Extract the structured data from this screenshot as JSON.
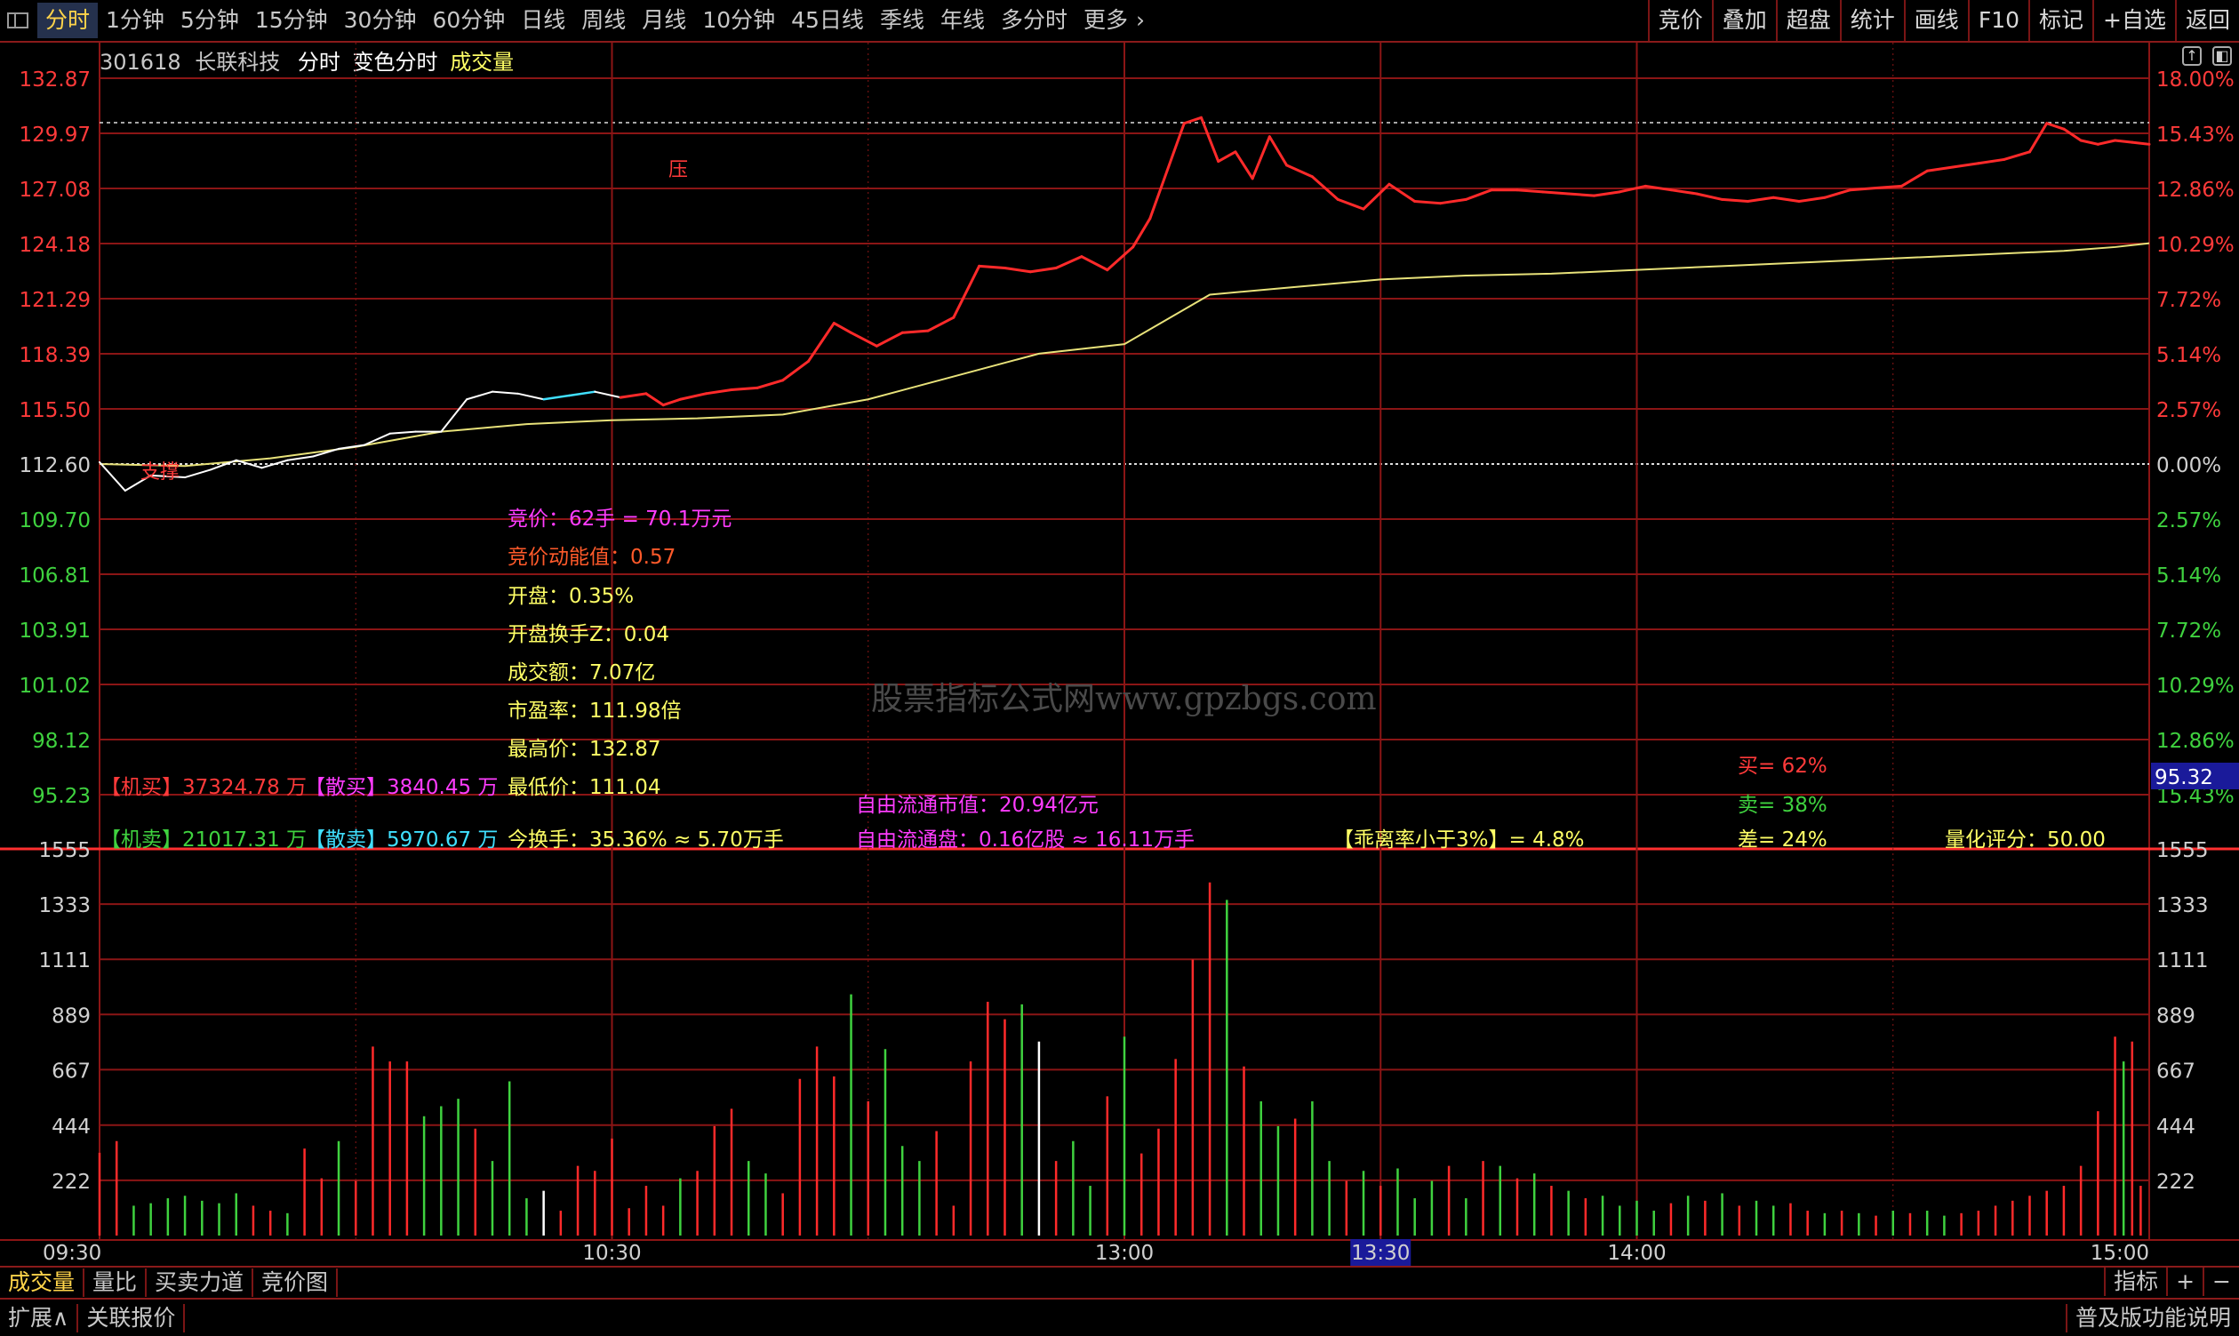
{
  "colors": {
    "up": "#ff2a2a",
    "down": "#3fd23f",
    "price_line": "#ffffff",
    "avg_line": "#e8e27a",
    "grid": "#8b1515",
    "label_yellow": "#ffff66",
    "label_magenta": "#ff3cff"
  },
  "toolbar": {
    "periods": [
      "分时",
      "1分钟",
      "5分钟",
      "15分钟",
      "30分钟",
      "60分钟",
      "日线",
      "周线",
      "月线",
      "10分钟",
      "45日线",
      "季线",
      "年线",
      "多分时",
      "更多"
    ],
    "active_period": "分时",
    "right_tools": [
      "竞价",
      "叠加",
      "超盘",
      "统计",
      "画线",
      "F10",
      "标记",
      "+自选",
      "返回"
    ]
  },
  "header": {
    "code": "301618",
    "name": "长联科技",
    "mode": "分时",
    "color_mode": "变色分时",
    "indicator": "成交量"
  },
  "price_axis": {
    "left": [
      "132.87",
      "129.97",
      "127.08",
      "124.18",
      "121.29",
      "118.39",
      "115.50",
      "112.60",
      "109.70",
      "106.81",
      "103.91",
      "101.02",
      "98.12",
      "95.23"
    ],
    "right": [
      "18.00%",
      "15.43%",
      "12.86%",
      "10.29%",
      "7.72%",
      "5.14%",
      "2.57%",
      "0.00%",
      "2.57%",
      "5.14%",
      "7.72%",
      "10.29%",
      "12.86%",
      "15.43%"
    ],
    "cursor_price": "95.32"
  },
  "volume_axis": {
    "labels": [
      "1555",
      "1333",
      "1111",
      "889",
      "667",
      "444",
      "222"
    ]
  },
  "time_axis": {
    "labels": [
      "09:30",
      "10:30",
      "13:00",
      "13:30",
      "14:00",
      "15:00"
    ],
    "highlight": "13:30"
  },
  "chart_labels": {
    "pressure": "压",
    "support": "支撑"
  },
  "info": {
    "auction": "竞价：62手 = 70.1万元",
    "auction_momentum": "竞价动能值：0.57",
    "open": "开盘：0.35%",
    "open_turnover": "开盘换手Z：0.04",
    "amount": "成交额：7.07亿",
    "pe": "市盈率：111.98倍",
    "high": "最高价：132.87",
    "low": "最低价：111.04",
    "turnover": "今换手：35.36% ≈ 5.70万手",
    "inst_buy": "【机买】37324.78 万",
    "retail_buy": "【散买】3840.45 万",
    "inst_sell": "【机卖】21017.31 万",
    "retail_sell": "【散卖】5970.67 万",
    "float_value": "自由流通市值：20.94亿元",
    "float_shares": "自由流通盘：0.16亿股 ≈ 16.11万手",
    "deviation": "【乖离率小于3%】= 4.8%",
    "buy_pct": "买= 62%",
    "sell_pct": "卖= 38%",
    "diff_pct": "差= 24%",
    "quant_score": "量化评分：50.00"
  },
  "watermark": "股票指标公式网www.gpzbgs.com",
  "bottom_tabs": [
    "成交量",
    "量比",
    "买卖力道",
    "竞价图"
  ],
  "bottom_right": [
    "指标",
    "+",
    "−"
  ],
  "status_bar": {
    "left": [
      "扩展∧",
      "关联报价"
    ],
    "right": "普及版功能说明"
  },
  "chart_data": {
    "type": "line",
    "prev_close": 112.6,
    "ylim": [
      95.23,
      132.87
    ],
    "x_range_minutes": 240,
    "price": [
      [
        0,
        112.7
      ],
      [
        3,
        111.2
      ],
      [
        6,
        112.0
      ],
      [
        10,
        111.9
      ],
      [
        13,
        112.3
      ],
      [
        16,
        112.8
      ],
      [
        19,
        112.4
      ],
      [
        22,
        112.8
      ],
      [
        25,
        113.0
      ],
      [
        28,
        113.4
      ],
      [
        31,
        113.6
      ],
      [
        34,
        114.2
      ],
      [
        37,
        114.3
      ],
      [
        40,
        114.3
      ],
      [
        43,
        116.0
      ],
      [
        46,
        116.4
      ],
      [
        49,
        116.3
      ],
      [
        52,
        116.0
      ],
      [
        55,
        116.2
      ],
      [
        58,
        116.4
      ],
      [
        61,
        116.1
      ],
      [
        64,
        116.3
      ],
      [
        66,
        115.7
      ],
      [
        68,
        116.0
      ],
      [
        71,
        116.3
      ],
      [
        74,
        116.5
      ],
      [
        77,
        116.6
      ],
      [
        80,
        117.0
      ],
      [
        83,
        118.0
      ],
      [
        86,
        120.0
      ],
      [
        88,
        119.5
      ],
      [
        91,
        118.8
      ],
      [
        94,
        119.5
      ],
      [
        97,
        119.6
      ],
      [
        100,
        120.3
      ],
      [
        103,
        123.0
      ],
      [
        106,
        122.9
      ],
      [
        109,
        122.7
      ],
      [
        112,
        122.9
      ],
      [
        115,
        123.5
      ],
      [
        118,
        122.8
      ],
      [
        121,
        124.0
      ],
      [
        123,
        125.5
      ],
      [
        125,
        128.0
      ],
      [
        127,
        130.5
      ],
      [
        129,
        130.8
      ],
      [
        131,
        128.5
      ],
      [
        133,
        129.0
      ],
      [
        135,
        127.6
      ],
      [
        137,
        129.8
      ],
      [
        139,
        128.3
      ],
      [
        142,
        127.7
      ],
      [
        145,
        126.5
      ],
      [
        148,
        126.0
      ],
      [
        151,
        127.3
      ],
      [
        154,
        126.4
      ],
      [
        157,
        126.3
      ],
      [
        160,
        126.5
      ],
      [
        163,
        127.0
      ],
      [
        166,
        127.0
      ],
      [
        169,
        126.9
      ],
      [
        172,
        126.8
      ],
      [
        175,
        126.7
      ],
      [
        178,
        126.9
      ],
      [
        181,
        127.2
      ],
      [
        184,
        127.0
      ],
      [
        187,
        126.8
      ],
      [
        190,
        126.5
      ],
      [
        193,
        126.4
      ],
      [
        196,
        126.6
      ],
      [
        199,
        126.4
      ],
      [
        202,
        126.6
      ],
      [
        205,
        127.0
      ],
      [
        208,
        127.1
      ],
      [
        211,
        127.2
      ],
      [
        214,
        128.0
      ],
      [
        217,
        128.2
      ],
      [
        220,
        128.4
      ],
      [
        223,
        128.6
      ],
      [
        226,
        129.0
      ],
      [
        228,
        130.5
      ],
      [
        230,
        130.2
      ],
      [
        232,
        129.6
      ],
      [
        234,
        129.4
      ],
      [
        236,
        129.6
      ],
      [
        238,
        129.5
      ],
      [
        240,
        129.4
      ]
    ],
    "avg": [
      [
        0,
        112.6
      ],
      [
        10,
        112.5
      ],
      [
        20,
        112.9
      ],
      [
        30,
        113.5
      ],
      [
        40,
        114.3
      ],
      [
        50,
        114.7
      ],
      [
        60,
        114.9
      ],
      [
        70,
        115.0
      ],
      [
        80,
        115.2
      ],
      [
        90,
        116.0
      ],
      [
        100,
        117.2
      ],
      [
        110,
        118.4
      ],
      [
        120,
        118.9
      ],
      [
        130,
        121.5
      ],
      [
        140,
        121.9
      ],
      [
        150,
        122.3
      ],
      [
        160,
        122.5
      ],
      [
        170,
        122.6
      ],
      [
        180,
        122.8
      ],
      [
        190,
        123.0
      ],
      [
        200,
        123.2
      ],
      [
        210,
        123.4
      ],
      [
        220,
        123.6
      ],
      [
        230,
        123.8
      ],
      [
        236,
        124.0
      ],
      [
        240,
        124.2
      ]
    ],
    "volume": [
      [
        0,
        333,
        0
      ],
      [
        2,
        380,
        0
      ],
      [
        4,
        120,
        1
      ],
      [
        6,
        130,
        1
      ],
      [
        8,
        150,
        1
      ],
      [
        10,
        160,
        1
      ],
      [
        12,
        140,
        1
      ],
      [
        14,
        130,
        1
      ],
      [
        16,
        170,
        1
      ],
      [
        18,
        120,
        0
      ],
      [
        20,
        100,
        0
      ],
      [
        22,
        90,
        1
      ],
      [
        24,
        350,
        0
      ],
      [
        26,
        230,
        0
      ],
      [
        28,
        380,
        1
      ],
      [
        30,
        220,
        0
      ],
      [
        32,
        760,
        0
      ],
      [
        34,
        700,
        0
      ],
      [
        36,
        700,
        0
      ],
      [
        38,
        480,
        1
      ],
      [
        40,
        520,
        1
      ],
      [
        42,
        550,
        1
      ],
      [
        44,
        430,
        0
      ],
      [
        46,
        300,
        1
      ],
      [
        48,
        620,
        1
      ],
      [
        50,
        150,
        1
      ],
      [
        52,
        180,
        2
      ],
      [
        54,
        100,
        0
      ],
      [
        56,
        280,
        0
      ],
      [
        58,
        260,
        0
      ],
      [
        60,
        390,
        0
      ],
      [
        62,
        110,
        0
      ],
      [
        64,
        200,
        0
      ],
      [
        66,
        120,
        0
      ],
      [
        68,
        230,
        1
      ],
      [
        70,
        260,
        0
      ],
      [
        72,
        440,
        0
      ],
      [
        74,
        510,
        0
      ],
      [
        76,
        300,
        1
      ],
      [
        78,
        250,
        1
      ],
      [
        80,
        170,
        0
      ],
      [
        82,
        630,
        0
      ],
      [
        84,
        760,
        0
      ],
      [
        86,
        640,
        0
      ],
      [
        88,
        970,
        1
      ],
      [
        90,
        540,
        0
      ],
      [
        92,
        750,
        1
      ],
      [
        94,
        360,
        1
      ],
      [
        96,
        300,
        1
      ],
      [
        98,
        420,
        0
      ],
      [
        100,
        120,
        0
      ],
      [
        102,
        700,
        0
      ],
      [
        104,
        940,
        0
      ],
      [
        106,
        870,
        0
      ],
      [
        108,
        930,
        1
      ],
      [
        110,
        780,
        2
      ],
      [
        112,
        300,
        0
      ],
      [
        114,
        380,
        1
      ],
      [
        116,
        200,
        1
      ],
      [
        118,
        560,
        0
      ],
      [
        120,
        800,
        1
      ],
      [
        122,
        330,
        0
      ],
      [
        124,
        430,
        0
      ],
      [
        126,
        710,
        0
      ],
      [
        128,
        1110,
        0
      ],
      [
        130,
        1420,
        0
      ],
      [
        132,
        1350,
        1
      ],
      [
        134,
        680,
        0
      ],
      [
        136,
        540,
        1
      ],
      [
        138,
        440,
        1
      ],
      [
        140,
        470,
        0
      ],
      [
        142,
        540,
        1
      ],
      [
        144,
        300,
        1
      ],
      [
        146,
        220,
        0
      ],
      [
        148,
        260,
        1
      ],
      [
        150,
        200,
        0
      ],
      [
        152,
        270,
        1
      ],
      [
        154,
        150,
        1
      ],
      [
        156,
        220,
        1
      ],
      [
        158,
        280,
        0
      ],
      [
        160,
        150,
        1
      ],
      [
        162,
        300,
        0
      ],
      [
        164,
        280,
        1
      ],
      [
        166,
        230,
        0
      ],
      [
        168,
        250,
        1
      ],
      [
        170,
        200,
        0
      ],
      [
        172,
        180,
        1
      ],
      [
        174,
        150,
        0
      ],
      [
        176,
        160,
        1
      ],
      [
        178,
        120,
        1
      ],
      [
        180,
        140,
        1
      ],
      [
        182,
        100,
        1
      ],
      [
        184,
        130,
        0
      ],
      [
        186,
        160,
        1
      ],
      [
        188,
        140,
        0
      ],
      [
        190,
        170,
        1
      ],
      [
        192,
        120,
        0
      ],
      [
        194,
        140,
        1
      ],
      [
        196,
        120,
        1
      ],
      [
        198,
        130,
        0
      ],
      [
        200,
        100,
        0
      ],
      [
        202,
        90,
        1
      ],
      [
        204,
        100,
        0
      ],
      [
        206,
        90,
        1
      ],
      [
        208,
        80,
        0
      ],
      [
        210,
        100,
        1
      ],
      [
        212,
        90,
        0
      ],
      [
        214,
        100,
        1
      ],
      [
        216,
        80,
        1
      ],
      [
        218,
        90,
        0
      ],
      [
        220,
        100,
        0
      ],
      [
        222,
        120,
        0
      ],
      [
        224,
        140,
        0
      ],
      [
        226,
        160,
        0
      ],
      [
        228,
        180,
        0
      ],
      [
        230,
        200,
        0
      ],
      [
        232,
        280,
        0
      ],
      [
        234,
        500,
        0
      ],
      [
        236,
        800,
        0
      ],
      [
        237,
        700,
        1
      ],
      [
        238,
        780,
        0
      ],
      [
        239,
        200,
        0
      ]
    ]
  }
}
